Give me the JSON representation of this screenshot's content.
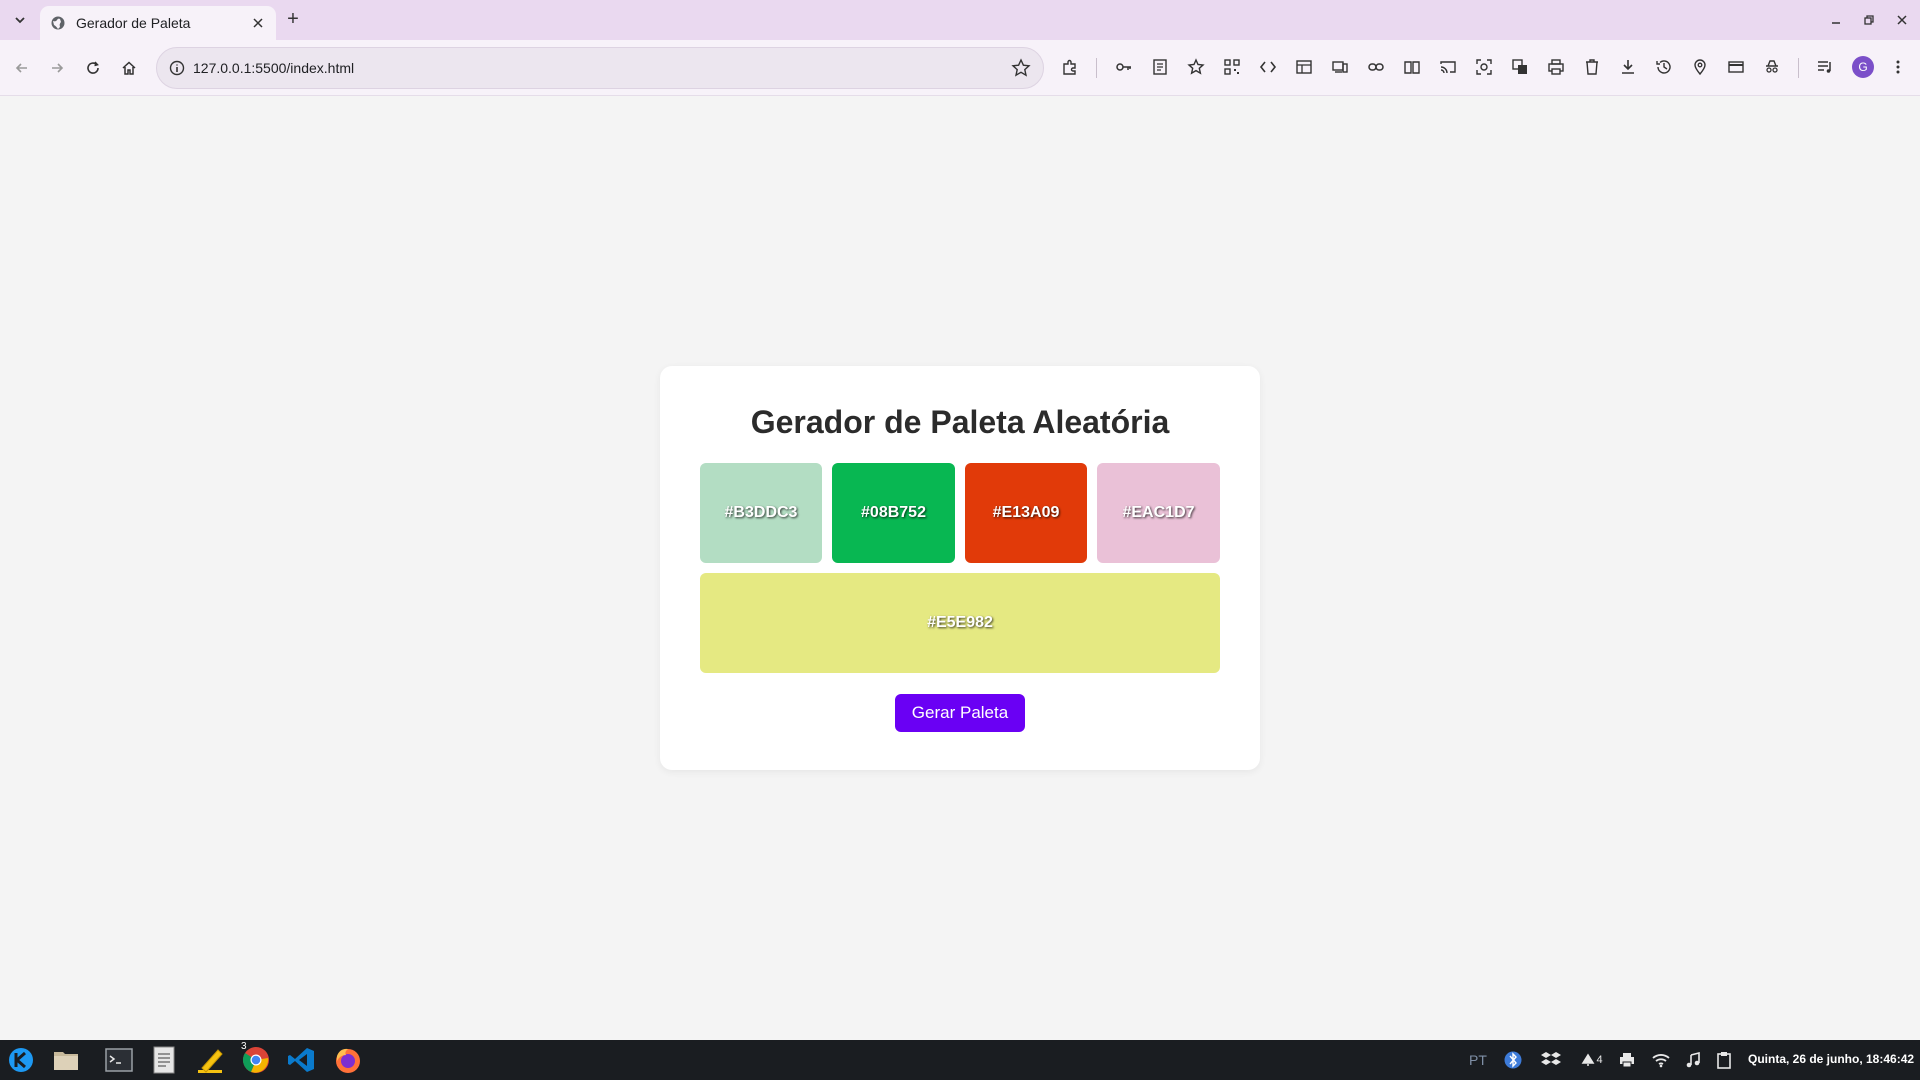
{
  "browser": {
    "tab_title": "Gerador de Paleta",
    "new_tab_label": "+",
    "url": "127.0.0.1:5500/index.html"
  },
  "page": {
    "title": "Gerador de Paleta Aleatória",
    "swatches": [
      {
        "label": "#B3DDC3",
        "color": "#B3DDC3"
      },
      {
        "label": "#08B752",
        "color": "#08B752"
      },
      {
        "label": "#E13A09",
        "color": "#E13A09"
      },
      {
        "label": "#EAC1D7",
        "color": "#EAC1D7"
      },
      {
        "label": "#E5E982",
        "color": "#E5E982"
      }
    ],
    "generate_button": "Gerar Paleta"
  },
  "profile": {
    "initial": "G"
  },
  "taskbar": {
    "chrome_badge": "3",
    "language": "PT",
    "notifications_count": "4",
    "clock": "Quinta, 26 de junho, 18:46:42"
  },
  "colors": {
    "accent": "#6A00F4",
    "tabstrip": "#EAD9F0",
    "taskbar": "#1A1D21"
  }
}
